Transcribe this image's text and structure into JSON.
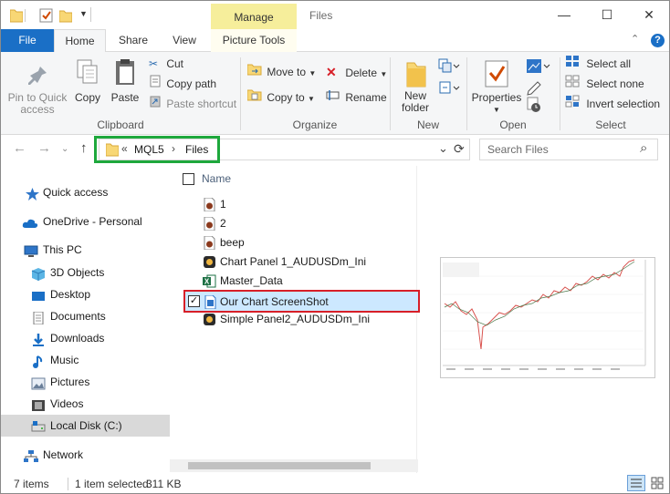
{
  "window": {
    "title": "Files",
    "contextual_tab": "Manage",
    "minimize_glyph": "—",
    "maximize_glyph": "☐",
    "close_glyph": "✕"
  },
  "tabs": {
    "file": "File",
    "home": "Home",
    "share": "Share",
    "view": "View",
    "picture_tools": "Picture Tools",
    "collapse_glyph": "⌃",
    "help_glyph": "?"
  },
  "ribbon": {
    "clipboard": {
      "label": "Clipboard",
      "pin_line1": "Pin to Quick",
      "pin_line2": "access",
      "copy": "Copy",
      "paste": "Paste",
      "cut": "Cut",
      "copy_path": "Copy path",
      "paste_shortcut": "Paste shortcut"
    },
    "organize": {
      "label": "Organize",
      "move_to": "Move to",
      "copy_to": "Copy to",
      "delete": "Delete",
      "rename": "Rename"
    },
    "new": {
      "label": "New",
      "new_folder_line1": "New",
      "new_folder_line2": "folder"
    },
    "open": {
      "label": "Open",
      "properties": "Properties"
    },
    "select": {
      "label": "Select",
      "select_all": "Select all",
      "select_none": "Select none",
      "invert_selection": "Invert selection"
    }
  },
  "address": {
    "back_glyph": "←",
    "forward_glyph": "→",
    "up_glyph": "↑",
    "dropdown_glyph": "⌄",
    "refresh_glyph": "⟳",
    "overflow_glyph": "«",
    "crumb_sep": "›",
    "crumbs": [
      "MQL5",
      "Files"
    ],
    "search_placeholder": "Search Files",
    "search_glyph": "⌕"
  },
  "nav": {
    "items": [
      {
        "label": "Quick access",
        "icon": "star-icon"
      },
      {
        "label": "OneDrive - Personal",
        "icon": "cloud-icon"
      },
      {
        "label": "This PC",
        "icon": "computer-icon"
      },
      {
        "label": "3D Objects",
        "icon": "cube-icon"
      },
      {
        "label": "Desktop",
        "icon": "desktop-icon"
      },
      {
        "label": "Documents",
        "icon": "documents-icon"
      },
      {
        "label": "Downloads",
        "icon": "download-icon"
      },
      {
        "label": "Music",
        "icon": "music-icon"
      },
      {
        "label": "Pictures",
        "icon": "pictures-icon"
      },
      {
        "label": "Videos",
        "icon": "videos-icon"
      },
      {
        "label": "Local Disk (C:)",
        "icon": "disk-icon"
      },
      {
        "label": "Network",
        "icon": "network-icon"
      }
    ]
  },
  "files": {
    "column_name": "Name",
    "check_glyph": "✓",
    "items": [
      {
        "name": "1",
        "icon": "audio-file-icon"
      },
      {
        "name": "2",
        "icon": "audio-file-icon"
      },
      {
        "name": "beep",
        "icon": "audio-file-icon"
      },
      {
        "name": "Chart Panel 1_AUDUSDm_Ini",
        "icon": "template-file-icon"
      },
      {
        "name": "Master_Data",
        "icon": "excel-file-icon"
      },
      {
        "name": "Our Chart ScreenShot",
        "icon": "image-file-icon",
        "selected": true
      },
      {
        "name": "Simple Panel2_AUDUSDm_Ini",
        "icon": "template-file-icon"
      }
    ]
  },
  "status": {
    "count": "7 items",
    "selection": "1 item selected",
    "size": "311 KB"
  },
  "colors": {
    "accent": "#1a6fc6",
    "manage_tab": "#f6ee9b",
    "highlight_green": "#1ea83c",
    "highlight_red": "#d71f28",
    "selection": "#cce8ff"
  }
}
